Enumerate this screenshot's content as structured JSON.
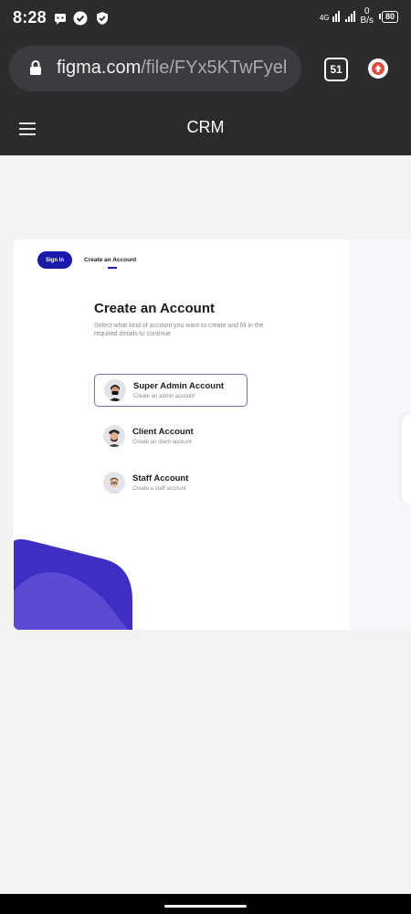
{
  "status": {
    "time": "8:28",
    "network": "4G",
    "speed_value": "0",
    "speed_unit": "B/s",
    "battery": "80"
  },
  "browser": {
    "url_host": "figma.com",
    "url_path": "/file/FYx5KTwFyel",
    "tab_count": "51"
  },
  "app": {
    "title": "CRM"
  },
  "auth": {
    "signin_label": "Sign In",
    "create_tab_label": "Create an Account",
    "heading": "Create an Account",
    "subheading": "Select what kind of account you want to create and fill in the required details to continue",
    "options": [
      {
        "title": "Super Admin Account",
        "subtitle": "Create an admin account"
      },
      {
        "title": "Client Account",
        "subtitle": "Create an client account"
      },
      {
        "title": "Staff Account",
        "subtitle": "Create a staff account"
      }
    ]
  },
  "colors": {
    "primary": "#1a1aa8",
    "deco_dark": "#3d2fc4",
    "deco_light": "#5b4bd4"
  }
}
